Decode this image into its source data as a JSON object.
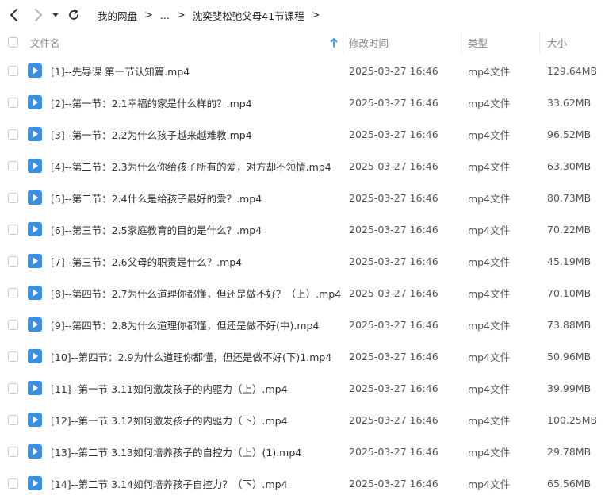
{
  "toolbar": {
    "back_icon": "chevron-left-icon",
    "forward_icon": "chevron-right-icon",
    "history_icon": "dropdown-triangle-icon",
    "refresh_icon": "refresh-icon"
  },
  "breadcrumb": {
    "items": [
      "我的网盘",
      "...",
      "沈奕斐松弛父母41节课程"
    ],
    "separator": ">"
  },
  "columns": {
    "name": "文件名",
    "modified": "修改时间",
    "type": "类型",
    "size": "大小",
    "sort_icon": "sort-ascending-arrow-icon"
  },
  "colors": {
    "accent": "#2e8ae6",
    "icon_blue": "#3b8fe0",
    "text": "#333333",
    "muted": "#888888"
  },
  "files": [
    {
      "name": "[1]--先导课 第一节认知篇.mp4",
      "modified": "2025-03-27 16:46",
      "type": "mp4文件",
      "size": "129.64MB"
    },
    {
      "name": "[2]--第一节：2.1幸福的家是什么样的？.mp4",
      "modified": "2025-03-27 16:46",
      "type": "mp4文件",
      "size": "33.62MB"
    },
    {
      "name": "[3]--第一节：2.2为什么孩子越来越难教.mp4",
      "modified": "2025-03-27 16:46",
      "type": "mp4文件",
      "size": "96.52MB"
    },
    {
      "name": "[4]--第二节：2.3为什么你给孩子所有的爱，对方却不领情.mp4",
      "modified": "2025-03-27 16:46",
      "type": "mp4文件",
      "size": "63.30MB"
    },
    {
      "name": "[5]--第二节：2.4什么是给孩子最好的爱？.mp4",
      "modified": "2025-03-27 16:46",
      "type": "mp4文件",
      "size": "80.73MB"
    },
    {
      "name": "[6]--第三节：2.5家庭教育的目的是什么？.mp4",
      "modified": "2025-03-27 16:46",
      "type": "mp4文件",
      "size": "70.22MB"
    },
    {
      "name": "[7]--第三节：2.6父母的职责是什么？.mp4",
      "modified": "2025-03-27 16:46",
      "type": "mp4文件",
      "size": "45.19MB"
    },
    {
      "name": "[8]--第四节：2.7为什么道理你都懂，但还是做不好？（上）.mp4",
      "modified": "2025-03-27 16:46",
      "type": "mp4文件",
      "size": "70.10MB"
    },
    {
      "name": "[9]--第四节：2.8为什么道理你都懂，但还是做不好(中).mp4",
      "modified": "2025-03-27 16:46",
      "type": "mp4文件",
      "size": "73.88MB"
    },
    {
      "name": "[10]--第四节：2.9为什么道理你都懂，但还是做不好(下)1.mp4",
      "modified": "2025-03-27 16:46",
      "type": "mp4文件",
      "size": "50.96MB"
    },
    {
      "name": "[11]--第一节 3.11如何激发孩子的内驱力（上）.mp4",
      "modified": "2025-03-27 16:46",
      "type": "mp4文件",
      "size": "39.99MB"
    },
    {
      "name": "[12]--第一节 3.12如何激发孩子的内驱力（下）.mp4",
      "modified": "2025-03-27 16:46",
      "type": "mp4文件",
      "size": "100.25MB"
    },
    {
      "name": "[13]--第二节 3.13如何培养孩子的自控力（上）(1).mp4",
      "modified": "2025-03-27 16:46",
      "type": "mp4文件",
      "size": "29.78MB"
    },
    {
      "name": "[14]--第二节 3.14如何培养孩子自控力？（下）.mp4",
      "modified": "2025-03-27 16:46",
      "type": "mp4文件",
      "size": "65.56MB"
    }
  ]
}
